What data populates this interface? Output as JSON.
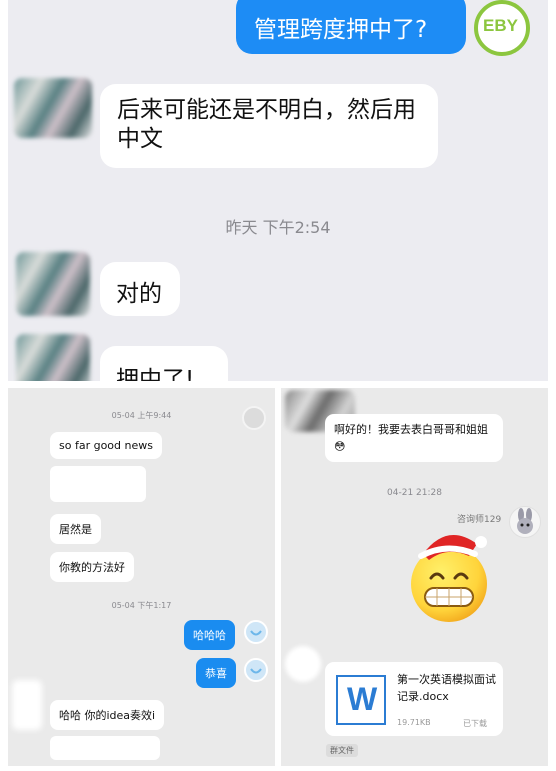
{
  "top_chat": {
    "outgoing_question": "管理跨度押中了?",
    "logo_text": "EBY",
    "message_1": "后来可能还是不明白，然后用中文",
    "timestamp": "昨天 下午2:54",
    "message_2": "对的",
    "message_3": "押中了!"
  },
  "left_chat": {
    "timestamp_1": "05-04 上午9:44",
    "msg_sofar": "so far good news",
    "msg_juran": "居然是",
    "msg_method": "你教的方法好",
    "timestamp_2": "05-04 下午1:17",
    "msg_hahaha": "哈哈哈",
    "msg_gongxi": "恭喜",
    "msg_idea": "哈哈 你的idea奏效i"
  },
  "right_chat": {
    "msg_top": "啊好的！我要去表白哥哥和姐姐",
    "emoji_inline": "😳",
    "timestamp": "04-21 21:28",
    "sender_name": "咨询师129",
    "file_icon_letter": "W",
    "file_name": "第一次英语模拟面试记录.docx",
    "file_size": "19.71KB",
    "file_status": "已下载",
    "file_source": "群文件"
  },
  "colors": {
    "bubble_blue": "#1d8cf5",
    "logo_green": "#8cc63f",
    "word_blue": "#2b7cd3",
    "emoji_yellow": "#ffd43b",
    "santa_red": "#e02525"
  }
}
